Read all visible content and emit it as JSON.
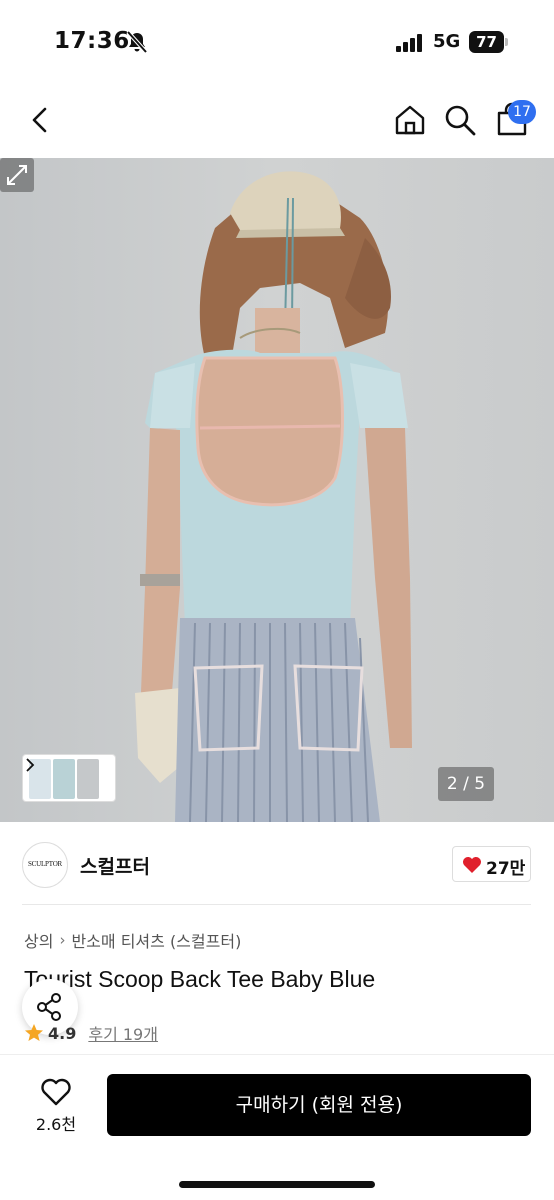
{
  "status_bar": {
    "time": "17:36",
    "network": "5G",
    "battery": "77"
  },
  "nav": {
    "cart_count": "17"
  },
  "gallery": {
    "page_indicator": "2 / 5"
  },
  "brand": {
    "name": "스컬프터",
    "logo_text": "SCULPTOR",
    "likes": "27만"
  },
  "breadcrumb": {
    "category": "상의",
    "sub_category": "반소매 티셔츠 (스컬프터)"
  },
  "product": {
    "title": "Tourist Scoop Back Tee Baby Blue",
    "rating": "4.9",
    "reviews": "후기 19개"
  },
  "bottom_bar": {
    "wish_count": "2.6천",
    "buy_label": "구매하기 (회원 전용)"
  },
  "colors": {
    "accent_blue": "#2f6ff0",
    "heart_red": "#e0202c",
    "star_yellow": "#f5a623",
    "button_black": "#000000"
  }
}
